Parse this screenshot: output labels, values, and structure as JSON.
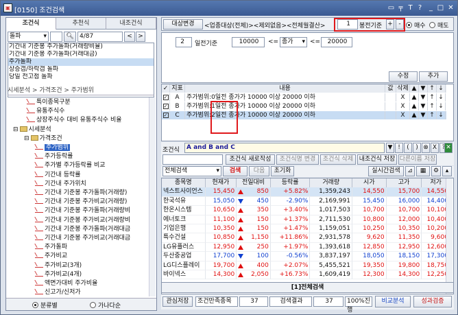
{
  "window": {
    "title": "[0150] 조건검색",
    "icon": "window-icon",
    "controls": [
      "image-icon",
      "pin-icon",
      "T",
      "?",
      "minimize-icon",
      "maximize-icon",
      "close-icon"
    ]
  },
  "left": {
    "tabs": [
      "조건식",
      "추천식",
      "내조건식"
    ],
    "category": "돌파",
    "search_value": "",
    "counter": "4/87",
    "prev": "<",
    "next": ">",
    "all": "전체",
    "list": [
      "기간내 기준봉 주가돌파(거래량비율)",
      "기간내 기준봉 주가돌파(거래대금)",
      "주가돌파",
      "상승갭/하락갭 돌파",
      "당일 전고점 돌파"
    ],
    "path": "시세분석 > 가격조건 > 주가범위",
    "tree": [
      {
        "t": "특이종목구분",
        "k": "doc",
        "x": 28
      },
      {
        "t": "유통주식수",
        "k": "doc",
        "x": 28
      },
      {
        "t": "상장주식수 대비 유통주식수 비율",
        "k": "doc",
        "x": 28
      },
      {
        "t": "시세분석",
        "k": "fold",
        "x": 8
      },
      {
        "t": "가격조건",
        "k": "fold",
        "x": 24
      },
      {
        "t": "주가범위",
        "k": "doc",
        "x": 40,
        "hl": true
      },
      {
        "t": "주가등락률",
        "k": "doc",
        "x": 40
      },
      {
        "t": "주가별 주가등락률 비교",
        "k": "doc",
        "x": 40
      },
      {
        "t": "기간내 등락률",
        "k": "doc",
        "x": 40
      },
      {
        "t": "기간내 주가위치",
        "k": "doc",
        "x": 40
      },
      {
        "t": "기간내 기준봉 주가돌파(거래량)",
        "k": "doc",
        "x": 40
      },
      {
        "t": "기간내 기준봉 주가비교(거래량)",
        "k": "doc",
        "x": 40
      },
      {
        "t": "기간내 기준봉 주가돌파(거래량비",
        "k": "doc",
        "x": 40
      },
      {
        "t": "기간내 기준봉 주가비교(거래량비",
        "k": "doc",
        "x": 40
      },
      {
        "t": "기간내 기준봉 주가돌파(거래대금",
        "k": "doc",
        "x": 40
      },
      {
        "t": "기간내 기준봉 주가비교(거래대금",
        "k": "doc",
        "x": 40
      },
      {
        "t": "주가돌파",
        "k": "doc",
        "x": 40
      },
      {
        "t": "주가비교",
        "k": "doc",
        "x": 40
      },
      {
        "t": "주가비교(3개)",
        "k": "doc",
        "x": 40
      },
      {
        "t": "주가비교(4개)",
        "k": "doc",
        "x": 40
      },
      {
        "t": "액면가대비 주가비율",
        "k": "doc",
        "x": 40
      },
      {
        "t": "신고가/신저가",
        "k": "doc",
        "x": 40
      }
    ],
    "radio_a": "분류별",
    "radio_b": "가나다순"
  },
  "right": {
    "target_label": "대상변경",
    "target_text": "<업종대상(전체)><제외없음><전체월결산>",
    "base_value": "1",
    "base_label": "봉전기준",
    "plus": "+",
    "minus": "-",
    "buy": "매수",
    "sell": "매도",
    "period_value": "2",
    "period_label": "일전기준",
    "min": "10000",
    "op1": "<=",
    "field": "종가",
    "op2": "<=",
    "max": "20000",
    "modify": "수정",
    "add": "추가",
    "cond_headers": [
      "지표",
      "내용",
      "값",
      "삭제",
      "▲",
      "▼",
      "↑",
      "↓"
    ],
    "conditions": [
      {
        "letter": "A",
        "pre": "주가범위:",
        "day": "0일전",
        "desc": " 종가가 10000 이상 20000 이하",
        "val": "",
        "del": "X"
      },
      {
        "letter": "B",
        "pre": "주가범위:",
        "day": "1일전",
        "desc": " 종가가 10000 이상 20000 이하",
        "val": "",
        "del": "X"
      },
      {
        "letter": "C",
        "pre": "주가범위:",
        "day": "2일전",
        "desc": " 종가가 10000 이상 20000 이하",
        "val": "",
        "del": "X"
      }
    ],
    "formula_label": "조건식",
    "formula": "A and B and C",
    "formula_btns": [
      "▼",
      "!",
      "(",
      ")",
      "⊗",
      "X",
      "?"
    ],
    "actions": [
      "조건식 새로작성",
      "조건식명 변경",
      "조건식 삭제",
      "내조건식 저장",
      "다른이름 저장"
    ],
    "result_combo": "전체검색",
    "search": "검색",
    "next": "다음",
    "reset": "초기화",
    "realtime": "실시간검색",
    "grid_headers": [
      "종목명",
      "현재가",
      "전일대비",
      "등락률",
      "거래량",
      "시가",
      "고가",
      "저가"
    ],
    "grid": [
      [
        "넥스트사이언스",
        "15,450",
        "up",
        "850",
        "+5.82%",
        "1,359,243",
        "14,550",
        "15,700",
        "14,550"
      ],
      [
        "한국석유",
        "15,050",
        "dn",
        "450",
        "-2.90%",
        "2,169,991",
        "15,450",
        "16,000",
        "14,400"
      ],
      [
        "한온시스템",
        "10,650",
        "up",
        "350",
        "+3.40%",
        "1,017,503",
        "10,700",
        "10,700",
        "10,100"
      ],
      [
        "에너토크",
        "11,100",
        "up",
        "150",
        "+1.37%",
        "2,711,530",
        "10,800",
        "12,000",
        "10,400"
      ],
      [
        "기업은행",
        "10,350",
        "up",
        "150",
        "+1.47%",
        "1,159,051",
        "10,250",
        "10,350",
        "10,200"
      ],
      [
        "특수건설",
        "10,850",
        "up",
        "1,150",
        "+11.86%",
        "2,931,578",
        "9,620",
        "11,350",
        "9,600"
      ],
      [
        "LG유플러스",
        "12,950",
        "up",
        "250",
        "+1.97%",
        "1,393,618",
        "12,850",
        "12,950",
        "12,600"
      ],
      [
        "두산중공업",
        "17,700",
        "dn",
        "100",
        "-0.56%",
        "3,837,197",
        "18,050",
        "18,150",
        "17,300"
      ],
      [
        "LG디스플레이",
        "19,700",
        "up",
        "400",
        "+2.07%",
        "5,455,521",
        "19,350",
        "19,800",
        "18,750"
      ],
      [
        "바이넥스",
        "14,300",
        "up",
        "2,050",
        "+16.73%",
        "1,609,419",
        "12,300",
        "14,300",
        "12,250"
      ]
    ],
    "grid_tab": "[1]전체검색",
    "footer": {
      "save": "관심저장",
      "count_label": "조건만족종목",
      "count": "37",
      "result_label": "검색결과",
      "result": "37",
      "progress": "100%진행",
      "compare": "비교분석",
      "verify": "성과검증"
    }
  }
}
